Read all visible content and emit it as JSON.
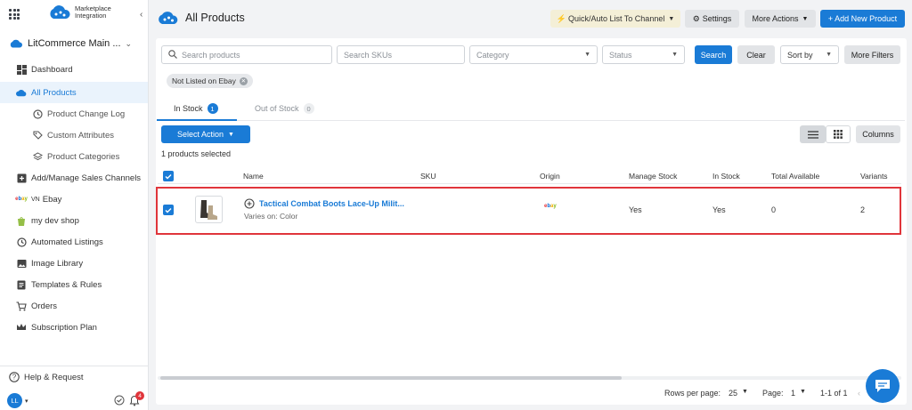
{
  "brand": {
    "line1": "Marketplace",
    "line2": "Integration"
  },
  "store": {
    "name": "LitCommerce Main ..."
  },
  "sidebar": {
    "items": [
      {
        "label": "Dashboard"
      },
      {
        "label": "All Products"
      },
      {
        "label": "Product Change Log"
      },
      {
        "label": "Custom Attributes"
      },
      {
        "label": "Product Categories"
      },
      {
        "label": "Add/Manage Sales Channels"
      },
      {
        "label": "Ebay",
        "prefix": "VN"
      },
      {
        "label": "my dev shop"
      },
      {
        "label": "Automated Listings"
      },
      {
        "label": "Image Library"
      },
      {
        "label": "Templates & Rules"
      },
      {
        "label": "Orders"
      },
      {
        "label": "Subscription Plan"
      }
    ],
    "help": "Help & Request",
    "user_initials": "LL",
    "notif_count": "4"
  },
  "header": {
    "title": "All Products",
    "quick_list": "Quick/Auto List To Channel",
    "settings": "Settings",
    "more_actions": "More Actions",
    "add_new": "+ Add New Product"
  },
  "filters": {
    "search_placeholder": "Search products",
    "sku_placeholder": "Search SKUs",
    "category": "Category",
    "status": "Status",
    "search_btn": "Search",
    "clear_btn": "Clear",
    "sort": "Sort by",
    "more_filters": "More Filters",
    "chip": "Not Listed on Ebay"
  },
  "tabs": [
    {
      "label": "In Stock",
      "count": "1"
    },
    {
      "label": "Out of Stock",
      "count": "0"
    }
  ],
  "toolbar": {
    "select_action": "Select Action",
    "selected_text": "1 products selected",
    "columns": "Columns"
  },
  "table": {
    "headers": [
      "Name",
      "SKU",
      "Origin",
      "Manage Stock",
      "In Stock",
      "Total Available",
      "Variants"
    ],
    "row": {
      "name": "Tactical Combat Boots Lace-Up Milit...",
      "varies": "Varies on: Color",
      "sku": "",
      "origin": "ebay",
      "manage_stock": "Yes",
      "in_stock": "Yes",
      "total_available": "0",
      "variants": "2"
    }
  },
  "pagination": {
    "rows_label": "Rows per page:",
    "rows_value": "25",
    "page_label": "Page:",
    "page_value": "1",
    "range": "1-1 of 1"
  },
  "colors": {
    "accent": "#1a7bd6",
    "highlight": "#e0353b"
  }
}
